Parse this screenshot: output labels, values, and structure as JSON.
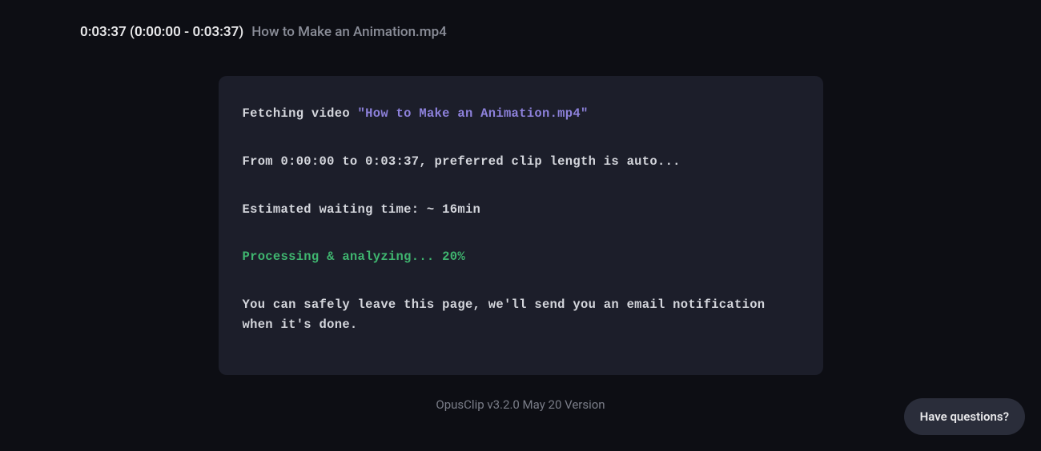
{
  "header": {
    "timestamp": "0:03:37 (0:00:00 - 0:03:37)",
    "filename": "How to Make an Animation.mp4"
  },
  "console": {
    "fetching_prefix": "Fetching video ",
    "fetching_filename": "\"How to Make an Animation.mp4\"",
    "range_line": "From 0:00:00 to 0:03:37, preferred clip length is auto...",
    "estimate_line": "Estimated waiting time: ~ 16min",
    "processing_line": "Processing & analyzing... 20%",
    "notice_line": "You can safely leave this page, we'll send you an email notification when it's done."
  },
  "footer": {
    "version": "OpusClip v3.2.0 May 20 Version"
  },
  "help": {
    "label": "Have questions?"
  }
}
